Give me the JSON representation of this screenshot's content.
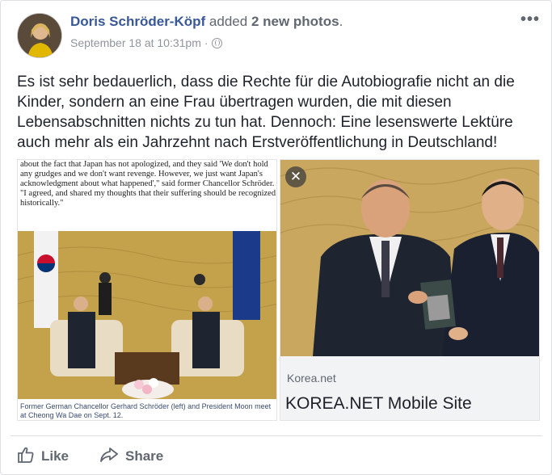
{
  "post": {
    "author": "Doris Schröder-Köpf",
    "action_prefix": "added",
    "action_count": "2 new photos",
    "action_suffix": ".",
    "timestamp": "September 18 at 10:31pm",
    "meta_separator": "·",
    "text": "Es ist sehr bedauerlich, dass die Rechte für die Autobiografie nicht an die Kinder, sondern an eine Frau übertragen wurden, die mit diesen Lebensabschnitten nichts zu tun hat. Dennoch: Eine lesenswerte Lektüre auch mehr als ein Jahrzehnt nach Erstveröffentlichung in Deutschland!",
    "more_icon": "more-horizontal-icon",
    "privacy_icon": "globe-icon"
  },
  "photo_left": {
    "article_text": "about the fact that Japan has not apologized, and they said 'We don't hold any grudges and we don't want revenge. However, we just want Japan's acknowledgment about what happened',\" said former Chancellor Schröder. \"I agreed, and shared my thoughts that their suffering should be recognized historically.\"",
    "caption": "Former German Chancellor Gerhard Schröder (left) and President Moon meet at Cheong Wa Dae on Sept. 12."
  },
  "photo_right": {
    "close_icon": "close-icon",
    "close_glyph": "✕",
    "link_domain": "Korea.net",
    "link_title": "KOREA.NET Mobile Site"
  },
  "actions": {
    "like_label": "Like",
    "share_label": "Share"
  },
  "colors": {
    "author_link": "#385898",
    "meta_text": "#90949c",
    "action_text": "#606770"
  }
}
